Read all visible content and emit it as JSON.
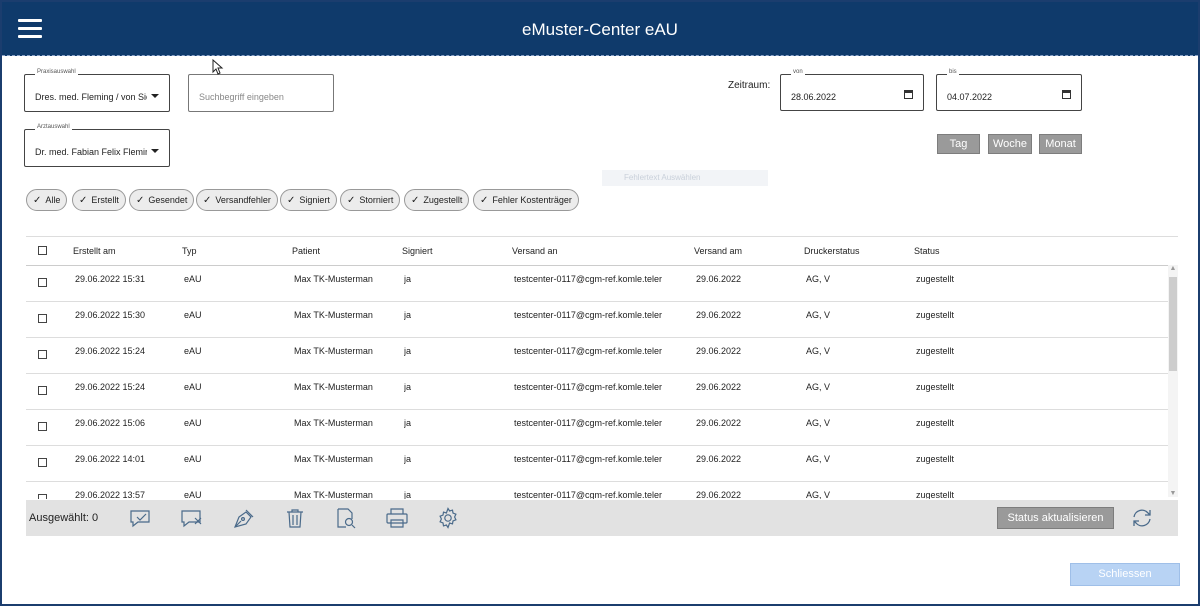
{
  "window": {
    "title": "eMuster-Center eAU"
  },
  "filters": {
    "praxis": {
      "legend": "Praxisauswahl",
      "value": "Dres. med. Fleming / von Sie"
    },
    "search": {
      "placeholder": "Suchbegriff eingeben"
    },
    "arzt": {
      "legend": "Arztauswahl",
      "value": "Dr. med. Fabian Felix Fleminc"
    },
    "zeitraum_label": "Zeitraum:",
    "von": {
      "legend": "von",
      "value": "28.06.2022"
    },
    "bis": {
      "legend": "bis",
      "value": "04.07.2022"
    },
    "period_buttons": {
      "tag": "Tag",
      "woche": "Woche",
      "monat": "Monat"
    },
    "ghost_text": "Fehlertext Auswählen"
  },
  "chips": [
    {
      "label": "Alle"
    },
    {
      "label": "Erstellt"
    },
    {
      "label": "Gesendet"
    },
    {
      "label": "Versandfehler"
    },
    {
      "label": "Signiert"
    },
    {
      "label": "Storniert"
    },
    {
      "label": "Zugestellt"
    },
    {
      "label": "Fehler Kostenträger"
    }
  ],
  "table": {
    "columns": [
      "Erstellt am",
      "Typ",
      "Patient",
      "Signiert",
      "Versand an",
      "Versand am",
      "Druckerstatus",
      "Status"
    ],
    "rows": [
      [
        "29.06.2022 15:31",
        "eAU",
        "Max TK-Musterman",
        "ja",
        "testcenter-0117@cgm-ref.komle.teler",
        "29.06.2022",
        "AG, V",
        "zugestellt"
      ],
      [
        "29.06.2022 15:30",
        "eAU",
        "Max TK-Musterman",
        "ja",
        "testcenter-0117@cgm-ref.komle.teler",
        "29.06.2022",
        "AG, V",
        "zugestellt"
      ],
      [
        "29.06.2022 15:24",
        "eAU",
        "Max TK-Musterman",
        "ja",
        "testcenter-0117@cgm-ref.komle.teler",
        "29.06.2022",
        "AG, V",
        "zugestellt"
      ],
      [
        "29.06.2022 15:24",
        "eAU",
        "Max TK-Musterman",
        "ja",
        "testcenter-0117@cgm-ref.komle.teler",
        "29.06.2022",
        "AG, V",
        "zugestellt"
      ],
      [
        "29.06.2022 15:06",
        "eAU",
        "Max TK-Musterman",
        "ja",
        "testcenter-0117@cgm-ref.komle.teler",
        "29.06.2022",
        "AG, V",
        "zugestellt"
      ],
      [
        "29.06.2022 14:01",
        "eAU",
        "Max TK-Musterman",
        "ja",
        "testcenter-0117@cgm-ref.komle.teler",
        "29.06.2022",
        "AG, V",
        "zugestellt"
      ],
      [
        "29.06.2022 13:57",
        "eAU",
        "Max TK-Musterman",
        "ja",
        "testcenter-0117@cgm-ref.komle.teler",
        "29.06.2022",
        "AG, V",
        "zugestellt"
      ]
    ]
  },
  "toolbar": {
    "selected": "Ausgewählt: 0",
    "status_button": "Status aktualisieren",
    "icons": [
      "sign-check-icon",
      "sign-cancel-icon",
      "pen-nib-icon",
      "trash-icon",
      "document-search-icon",
      "printer-icon",
      "gear-icon"
    ]
  },
  "footer": {
    "close": "Schliessen"
  },
  "colors": {
    "titlebar": "#0f3a6b",
    "button_gray": "#9a9a9a",
    "close_button": "#b8d3f4"
  }
}
